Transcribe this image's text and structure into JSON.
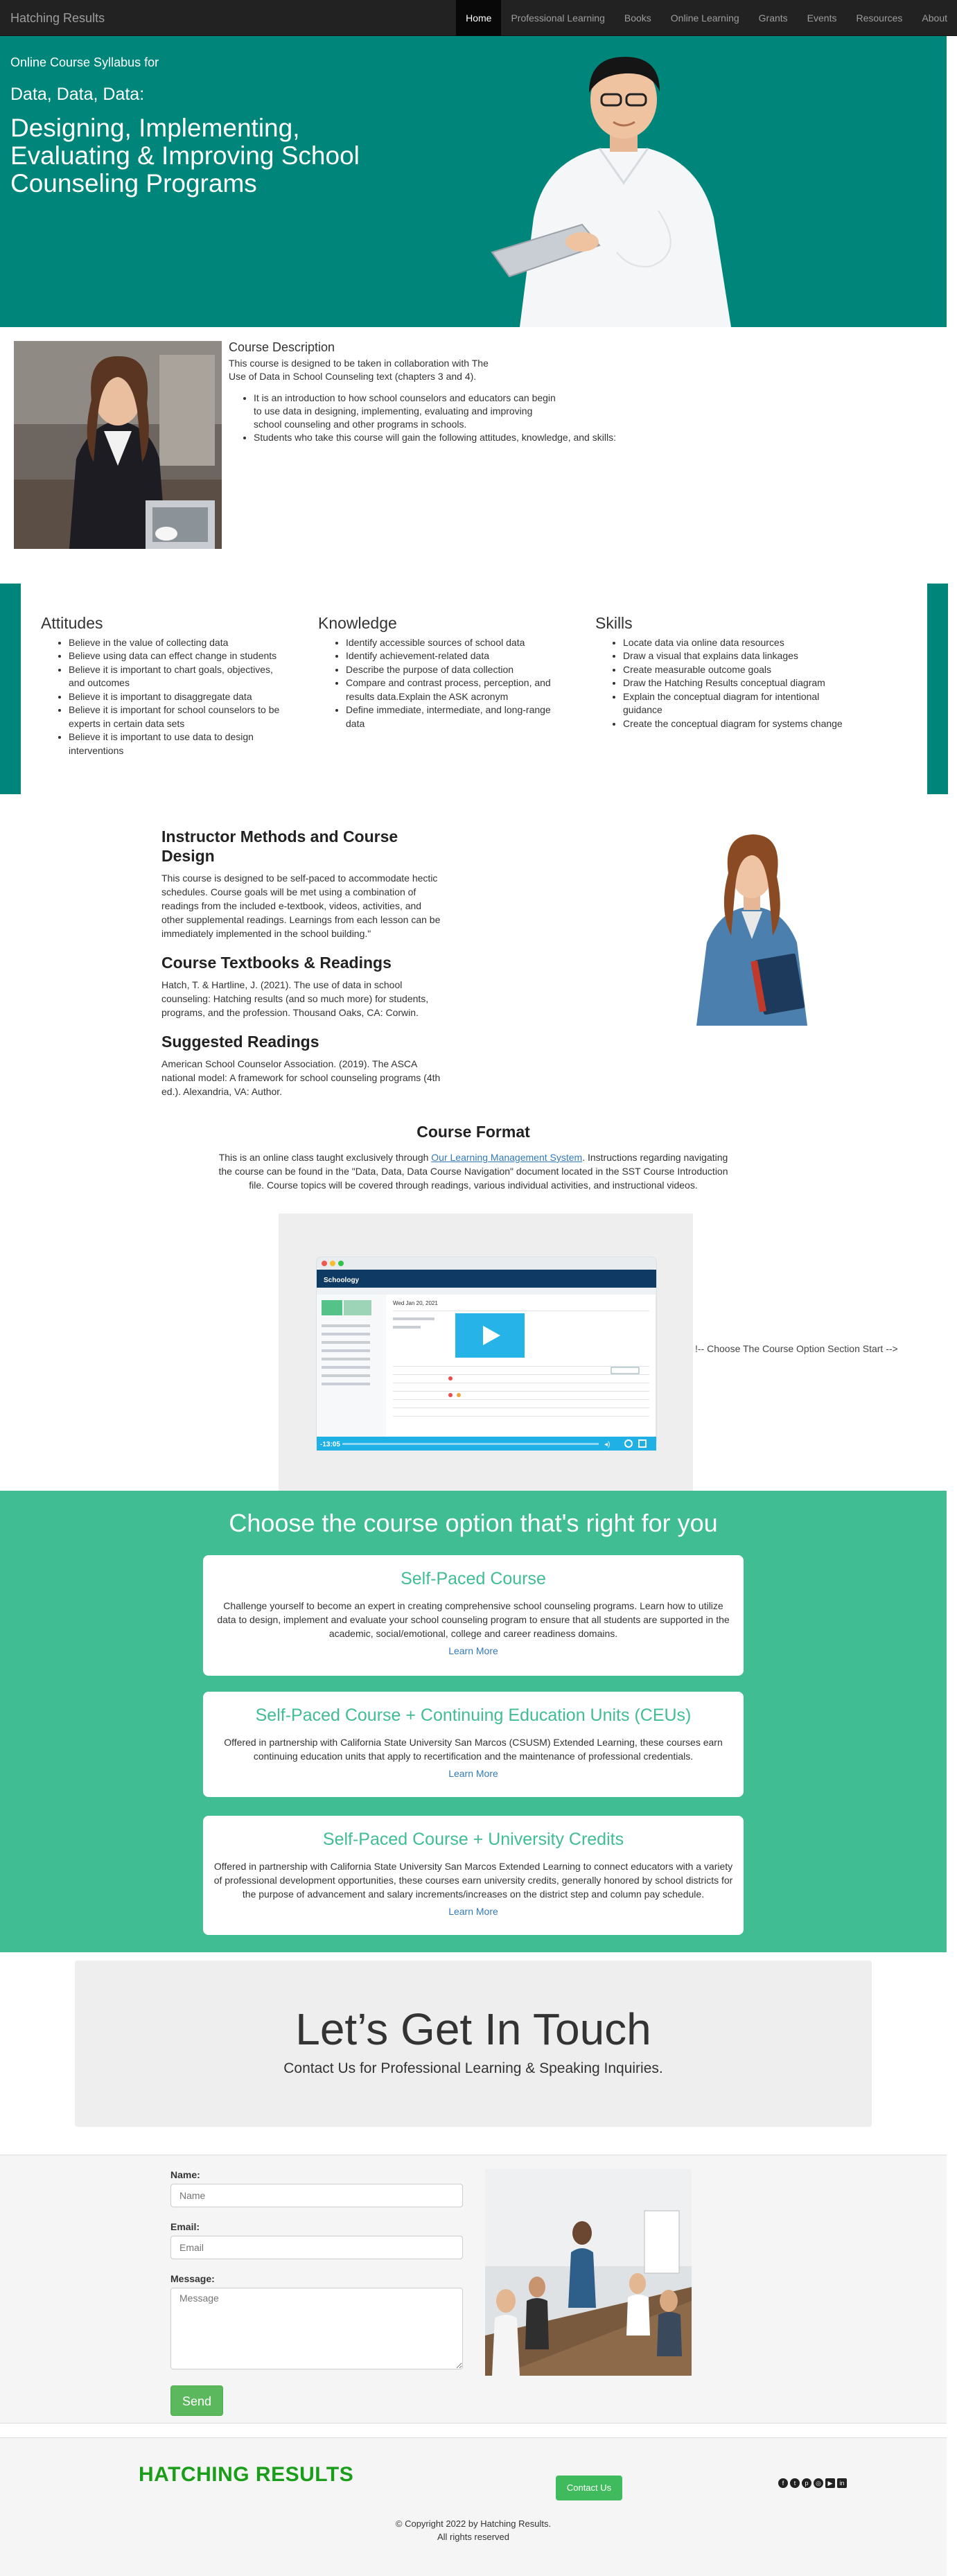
{
  "nav": {
    "brand": "Hatching Results",
    "items": [
      "Home",
      "Professional Learning",
      "Books",
      "Online Learning",
      "Grants",
      "Events",
      "Resources",
      "About"
    ]
  },
  "hero": {
    "kicker": "Online Course Syllabus for",
    "subtitle": "Data, Data, Data:",
    "title": "Designing, Implementing, Evaluating & Improving School Counseling Programs"
  },
  "description": {
    "heading": "Course Description",
    "intro": "This course is designed to be taken in collaboration with The Use of Data in School Counseling text (chapters 3 and 4).",
    "bullets": [
      "It is an introduction to how school counselors and educators can begin to use data in designing, implementing, evaluating and improving school counseling and other programs in schools.",
      "Students who take this course will gain the following attitudes, knowledge, and skills:"
    ]
  },
  "outcomes": {
    "attitudes": {
      "heading": "Attitudes",
      "items": [
        "Believe in the value of collecting data",
        "Believe using data can effect change in students",
        "Believe it is important to chart goals, objectives, and outcomes",
        "Believe it is important to disaggregate data",
        "Believe it is important for school counselors to be experts in certain data sets",
        "Believe it is important to use data to design interventions"
      ]
    },
    "knowledge": {
      "heading": "Knowledge",
      "items": [
        "Identify accessible sources of school data",
        "Identify achievement-related data",
        "Describe the purpose of data collection",
        "Compare and contrast process, perception, and results data.Explain the ASK acronym",
        "Define immediate, intermediate, and long-range data"
      ]
    },
    "skills": {
      "heading": "Skills",
      "items": [
        "Locate data via online data resources",
        "Draw a visual that explains data linkages",
        "Create measurable outcome goals",
        "Draw the Hatching Results conceptual diagram",
        "Explain the conceptual diagram for intentional guidance",
        "Create the conceptual diagram for systems change"
      ]
    }
  },
  "instructor": {
    "heading": "Instructor Methods and Course Design",
    "text": "This course is designed to be self-paced to accommodate hectic schedules. Course goals will be met using a combination of readings from the included e-textbook, videos, activities, and other supplemental readings. Learnings from each lesson can be immediately implemented in the school building.\"",
    "textbooks_heading": "Course Textbooks & Readings",
    "textbooks_text": "Hatch, T. & Hartline, J. (2021). The use of data in school counseling: Hatching results (and so much more) for students, programs, and the profession. Thousand Oaks, CA: Corwin.",
    "suggested_heading": "Suggested Readings",
    "suggested_text": "American School Counselor Association. (2019). The ASCA national model: A framework for school counseling programs (4th ed.). Alexandria, VA: Author."
  },
  "format": {
    "heading": "Course Format",
    "text_before": "This is an online class taught exclusively through ",
    "link": "Our Learning Management System",
    "text_after": ". Instructions regarding navigating the course can be found in the \"Data, Data, Data Course Navigation\" document located in the SST Course Introduction file. Course topics will be covered through readings, various individual activities, and instructional videos.",
    "note": "!-- Choose The Course Option Section Start -->",
    "video": {
      "logo": "Schoology",
      "date": "Wed Jan 20, 2021",
      "time": "-13:05"
    }
  },
  "options": {
    "heading": "Choose the course option that's right for you",
    "cards": [
      {
        "title": "Self-Paced Course",
        "text": "Challenge yourself to become an expert in creating comprehensive school counseling programs. Learn how to utilize data to design, implement and evaluate your school counseling program to ensure that all students are supported in the academic, social/emotional, college and career readiness domains.",
        "link": "Learn More"
      },
      {
        "title": "Self-Paced Course + Continuing Education Units (CEUs)",
        "text": "Offered in partnership with California State University San Marcos (CSUSM) Extended Learning, these courses earn continuing education units that apply to recertification and the maintenance of professional credentials.",
        "link": "Learn More"
      },
      {
        "title": "Self-Paced Course + University Credits",
        "text": "Offered in partnership with California State University San Marcos Extended Learning to connect educators with a variety of professional development opportunities, these courses earn university credits, generally honored by school districts for the purpose of advancement and salary increments/increases on the district step and column pay schedule.",
        "link": "Learn More"
      }
    ]
  },
  "touch": {
    "heading": "Let’s Get In Touch",
    "sub": "Contact Us for Professional Learning & Speaking Inquiries."
  },
  "contact": {
    "name_label": "Name:",
    "name_placeholder": "Name",
    "email_label": "Email:",
    "email_placeholder": "Email",
    "message_label": "Message:",
    "message_placeholder": "Message",
    "send": "Send"
  },
  "footer": {
    "logo": "HATCHING RESULTS",
    "cta": "Contact Us",
    "social": [
      "facebook-icon",
      "twitter-icon",
      "pinterest-icon",
      "instagram-icon",
      "youtube-icon",
      "linkedin-icon"
    ],
    "copyright": "© Copyright 2022 by Hatching Results.",
    "rights": "All rights reserved"
  },
  "colors": {
    "teal": "#00857a",
    "green": "#41bd93",
    "nav": "#222222",
    "logo_green": "#1a9e1a"
  }
}
